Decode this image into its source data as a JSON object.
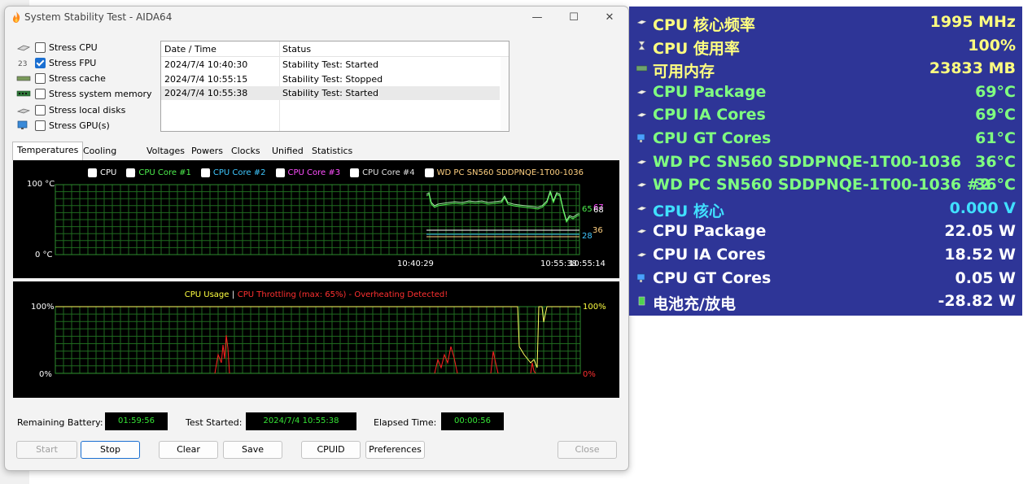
{
  "window": {
    "title": "System Stability Test - AIDA64",
    "controls": [
      "—",
      "☐",
      "✕"
    ]
  },
  "stress_options": [
    {
      "label": "Stress CPU",
      "checked": false,
      "icon": "cpu-icon"
    },
    {
      "label": "Stress FPU",
      "checked": true,
      "icon": "fpu-icon"
    },
    {
      "label": "Stress cache",
      "checked": false,
      "icon": "cache-icon"
    },
    {
      "label": "Stress system memory",
      "checked": false,
      "icon": "memory-icon"
    },
    {
      "label": "Stress local disks",
      "checked": false,
      "icon": "disk-icon"
    },
    {
      "label": "Stress GPU(s)",
      "checked": false,
      "icon": "gpu-icon"
    }
  ],
  "log": {
    "headers": [
      "Date / Time",
      "Status"
    ],
    "rows": [
      {
        "time": "2024/7/4 10:40:30",
        "status": "Stability Test: Started"
      },
      {
        "time": "2024/7/4 10:55:15",
        "status": "Stability Test: Stopped"
      },
      {
        "time": "2024/7/4 10:55:38",
        "status": "Stability Test: Started"
      }
    ]
  },
  "tabs": [
    "Temperatures",
    "Cooling Fans",
    "Voltages",
    "Powers",
    "Clocks",
    "Unified",
    "Statistics"
  ],
  "temp_graph": {
    "legend": [
      {
        "label": "CPU",
        "color": "#ffffff"
      },
      {
        "label": "CPU Core #1",
        "color": "#4ef04e"
      },
      {
        "label": "CPU Core #2",
        "color": "#3fc8ff"
      },
      {
        "label": "CPU Core #3",
        "color": "#ff4fff"
      },
      {
        "label": "CPU Core #4",
        "color": "#e0e0e0"
      },
      {
        "label": "WD PC SN560 SDDPNQE-1T00-1036",
        "color": "#ffd080"
      }
    ],
    "y_top": "100 °C",
    "y_bottom": "0 °C",
    "x_labels": [
      "10:40:29",
      "10:55:38",
      "10:55:14"
    ],
    "right_values": [
      {
        "text": "65",
        "color": "#4ef04e"
      },
      {
        "text": "67",
        "color": "#ff4fff"
      },
      {
        "text": "68",
        "color": "#ffffff"
      },
      {
        "text": "28",
        "color": "#3fc8ff"
      },
      {
        "text": "36",
        "color": "#ffd080"
      }
    ]
  },
  "cpu_graph": {
    "title_usage": "CPU Usage",
    "separator": "|",
    "title_throttle": "CPU Throttling (max: 65%) - Overheating Detected!",
    "y_top_left": "100%",
    "y_bottom_left": "0%",
    "y_top_right": "100%",
    "y_bottom_right": "0%"
  },
  "status": {
    "battery_label": "Remaining Battery:",
    "battery_value": "01:59:56",
    "started_label": "Test Started:",
    "started_value": "2024/7/4 10:55:38",
    "elapsed_label": "Elapsed Time:",
    "elapsed_value": "00:00:56"
  },
  "buttons": {
    "start": "Start",
    "stop": "Stop",
    "clear": "Clear",
    "save": "Save",
    "cpuid": "CPUID",
    "preferences": "Preferences",
    "close": "Close"
  },
  "sensors": [
    {
      "name": "CPU 核心频率",
      "value": "1995 MHz",
      "color": "#ffff80",
      "icon": "cpu-icon"
    },
    {
      "name": "CPU 使用率",
      "value": "100%",
      "color": "#ffff80",
      "icon": "hourglass-icon"
    },
    {
      "name": "可用内存",
      "value": "23833 MB",
      "color": "#ffff80",
      "icon": "memory-icon"
    },
    {
      "name": "CPU Package",
      "value": "69°C",
      "color": "#80ff80",
      "icon": "cpu-icon"
    },
    {
      "name": "CPU IA Cores",
      "value": "69°C",
      "color": "#80ff80",
      "icon": "cpu-icon"
    },
    {
      "name": "CPU GT Cores",
      "value": "61°C",
      "color": "#80ff80",
      "icon": "gpu-icon"
    },
    {
      "name": "WD PC SN560 SDDPNQE-1T00-1036",
      "value": "36°C",
      "color": "#80ff80",
      "icon": "disk-icon"
    },
    {
      "name": "WD PC SN560 SDDPNQE-1T00-1036 #2",
      "value": "36°C",
      "color": "#80ff80",
      "icon": "disk-icon"
    },
    {
      "name": "CPU 核心",
      "value": "0.000 V",
      "color": "#40e0ff",
      "icon": "cpu-icon"
    },
    {
      "name": "CPU Package",
      "value": "22.05 W",
      "color": "#ffffff",
      "icon": "cpu-icon"
    },
    {
      "name": "CPU IA Cores",
      "value": "18.52 W",
      "color": "#ffffff",
      "icon": "cpu-icon"
    },
    {
      "name": "CPU GT Cores",
      "value": "0.05 W",
      "color": "#ffffff",
      "icon": "gpu-icon"
    },
    {
      "name": "电池充/放电",
      "value": "-28.82 W",
      "color": "#ffffff",
      "icon": "battery-icon"
    }
  ]
}
